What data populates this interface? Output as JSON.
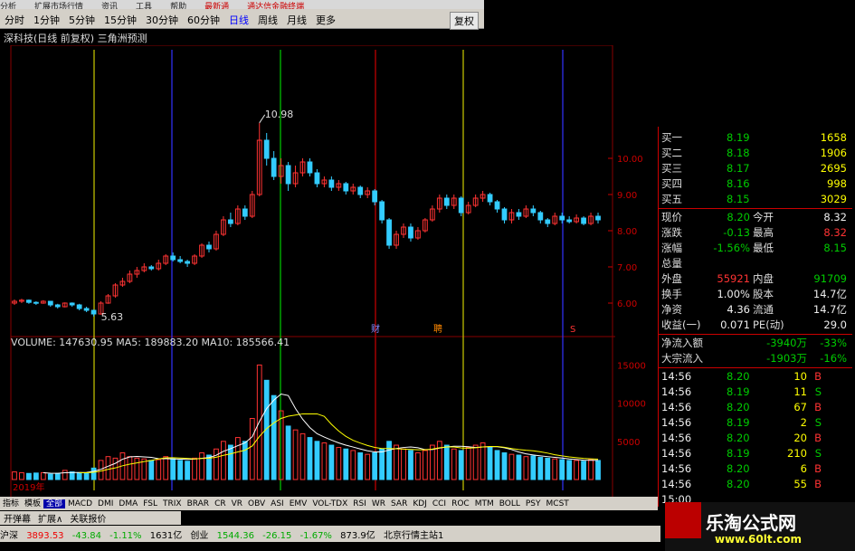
{
  "menubar": {
    "items": [
      "分析",
      "扩展市场行情",
      "资讯",
      "工具",
      "帮助"
    ],
    "red1": "最新通",
    "red2": "通达信金融终端"
  },
  "periods": [
    "分时",
    "1分钟",
    "5分钟",
    "15分钟",
    "30分钟",
    "60分钟",
    "日线",
    "周线",
    "月线",
    "更多"
  ],
  "active_period": "日线",
  "fuquan_btn": "复权",
  "chart_title": "深科技(日线 前复权) 三角洲预测",
  "price_high_label": "10.98",
  "price_low_label": "5.63",
  "year_label": "2019年",
  "event_labels": [
    "财",
    "聘",
    "S"
  ],
  "volume": {
    "label": "VOLUME: 147630.95",
    "ma5": "MA5: 189883.20",
    "ma10": "MA10: 185566.41"
  },
  "price_axis": [
    "10.00",
    "9.00",
    "8.00",
    "7.00",
    "6.00"
  ],
  "volume_axis": [
    "15000",
    "10000",
    "5000"
  ],
  "chart_data": {
    "type": "candlestick",
    "ylim": [
      5.5,
      11
    ],
    "volume_ylim": [
      0,
      16000
    ],
    "candles": [
      [
        6.0,
        6.05,
        6.1,
        5.95
      ],
      [
        6.05,
        6.08,
        6.12,
        6.0
      ],
      [
        6.08,
        6.02,
        6.1,
        5.98
      ],
      [
        6.02,
        6.0,
        6.05,
        5.95
      ],
      [
        6.0,
        6.05,
        6.08,
        5.98
      ],
      [
        6.05,
        5.95,
        6.06,
        5.9
      ],
      [
        5.95,
        5.9,
        5.98,
        5.85
      ],
      [
        5.9,
        6.0,
        6.02,
        5.88
      ],
      [
        6.0,
        5.95,
        6.02,
        5.9
      ],
      [
        5.95,
        5.85,
        5.98,
        5.8
      ],
      [
        5.85,
        5.8,
        5.9,
        5.75
      ],
      [
        5.8,
        5.7,
        5.82,
        5.63
      ],
      [
        5.7,
        6.0,
        6.05,
        5.68
      ],
      [
        6.0,
        6.2,
        6.25,
        5.98
      ],
      [
        6.2,
        6.5,
        6.55,
        6.15
      ],
      [
        6.5,
        6.6,
        6.7,
        6.45
      ],
      [
        6.6,
        6.8,
        6.9,
        6.55
      ],
      [
        6.8,
        6.9,
        7.0,
        6.7
      ],
      [
        6.9,
        7.0,
        7.1,
        6.85
      ],
      [
        7.0,
        6.95,
        7.05,
        6.9
      ],
      [
        6.95,
        7.1,
        7.2,
        6.9
      ],
      [
        7.1,
        7.3,
        7.35,
        7.05
      ],
      [
        7.3,
        7.2,
        7.4,
        7.15
      ],
      [
        7.2,
        7.15,
        7.3,
        7.1
      ],
      [
        7.15,
        7.1,
        7.2,
        7.0
      ],
      [
        7.1,
        7.3,
        7.35,
        7.05
      ],
      [
        7.3,
        7.6,
        7.65,
        7.25
      ],
      [
        7.6,
        7.5,
        7.7,
        7.4
      ],
      [
        7.5,
        7.9,
        8.0,
        7.45
      ],
      [
        7.9,
        8.3,
        8.4,
        7.85
      ],
      [
        8.3,
        8.2,
        8.5,
        8.1
      ],
      [
        8.2,
        8.6,
        8.7,
        8.15
      ],
      [
        8.6,
        8.4,
        8.7,
        8.3
      ],
      [
        8.4,
        9.0,
        9.1,
        8.35
      ],
      [
        9.0,
        10.5,
        10.98,
        8.95
      ],
      [
        10.5,
        10.0,
        10.7,
        9.8
      ],
      [
        10.0,
        9.5,
        10.2,
        9.4
      ],
      [
        9.5,
        9.8,
        10.0,
        9.3
      ],
      [
        9.8,
        9.3,
        9.9,
        9.1
      ],
      [
        9.3,
        9.6,
        9.8,
        9.2
      ],
      [
        9.6,
        9.9,
        10.0,
        9.5
      ],
      [
        9.9,
        9.6,
        10.0,
        9.5
      ],
      [
        9.6,
        9.3,
        9.7,
        9.2
      ],
      [
        9.3,
        9.4,
        9.5,
        9.2
      ],
      [
        9.4,
        9.2,
        9.5,
        9.1
      ],
      [
        9.2,
        9.3,
        9.4,
        9.1
      ],
      [
        9.3,
        9.1,
        9.35,
        9.0
      ],
      [
        9.1,
        9.2,
        9.3,
        9.0
      ],
      [
        9.2,
        9.0,
        9.25,
        8.9
      ],
      [
        9.0,
        9.1,
        9.2,
        8.9
      ],
      [
        9.1,
        8.8,
        9.15,
        8.7
      ],
      [
        8.8,
        8.3,
        8.85,
        8.2
      ],
      [
        8.3,
        7.6,
        8.35,
        7.5
      ],
      [
        7.6,
        7.9,
        8.0,
        7.5
      ],
      [
        7.9,
        8.1,
        8.2,
        7.8
      ],
      [
        8.1,
        7.8,
        8.2,
        7.7
      ],
      [
        7.8,
        8.0,
        8.1,
        7.75
      ],
      [
        8.0,
        8.3,
        8.35,
        7.95
      ],
      [
        8.3,
        8.6,
        8.7,
        8.25
      ],
      [
        8.6,
        8.9,
        9.0,
        8.5
      ],
      [
        8.9,
        8.7,
        9.0,
        8.6
      ],
      [
        8.7,
        8.9,
        9.0,
        8.6
      ],
      [
        8.9,
        8.5,
        8.95,
        8.4
      ],
      [
        8.5,
        8.7,
        8.8,
        8.45
      ],
      [
        8.7,
        8.9,
        9.0,
        8.65
      ],
      [
        8.9,
        9.0,
        9.1,
        8.8
      ],
      [
        9.0,
        8.8,
        9.05,
        8.7
      ],
      [
        8.8,
        8.6,
        8.85,
        8.5
      ],
      [
        8.6,
        8.3,
        8.65,
        8.2
      ],
      [
        8.3,
        8.5,
        8.6,
        8.2
      ],
      [
        8.5,
        8.4,
        8.6,
        8.3
      ],
      [
        8.4,
        8.6,
        8.7,
        8.35
      ],
      [
        8.6,
        8.5,
        8.7,
        8.4
      ],
      [
        8.5,
        8.3,
        8.55,
        8.2
      ],
      [
        8.3,
        8.2,
        8.35,
        8.1
      ],
      [
        8.2,
        8.4,
        8.5,
        8.15
      ],
      [
        8.4,
        8.3,
        8.5,
        8.2
      ],
      [
        8.3,
        8.25,
        8.4,
        8.2
      ],
      [
        8.25,
        8.35,
        8.45,
        8.2
      ],
      [
        8.35,
        8.2,
        8.4,
        8.15
      ],
      [
        8.2,
        8.4,
        8.5,
        8.15
      ],
      [
        8.4,
        8.3,
        8.5,
        8.2
      ]
    ],
    "volumes": [
      1000,
      900,
      800,
      850,
      900,
      700,
      800,
      1200,
      1000,
      900,
      800,
      1500,
      2500,
      3000,
      2800,
      3500,
      3000,
      2800,
      2700,
      2500,
      2600,
      3000,
      2700,
      2500,
      2400,
      2800,
      3500,
      3200,
      4000,
      5000,
      4500,
      5500,
      5000,
      8000,
      15000,
      13000,
      11000,
      9000,
      7000,
      6500,
      6000,
      5500,
      5000,
      4800,
      4500,
      4200,
      4000,
      3800,
      3500,
      3300,
      3500,
      4000,
      5000,
      4500,
      4000,
      3800,
      3500,
      3800,
      4500,
      5000,
      4500,
      4000,
      3800,
      4200,
      4500,
      4800,
      4200,
      3800,
      3500,
      3300,
      3200,
      3000,
      3100,
      2900,
      2800,
      2700,
      2600,
      2500,
      2500,
      2400,
      2600,
      2500
    ]
  },
  "quote": {
    "bids": [
      {
        "label": "买一",
        "price": "8.19",
        "vol": "1658"
      },
      {
        "label": "买二",
        "price": "8.18",
        "vol": "1906"
      },
      {
        "label": "买三",
        "price": "8.17",
        "vol": "2695"
      },
      {
        "label": "买四",
        "price": "8.16",
        "vol": "998"
      },
      {
        "label": "买五",
        "price": "8.15",
        "vol": "3029"
      }
    ],
    "stats": [
      {
        "l1": "现价",
        "v1": "8.20",
        "l2": "今开",
        "v2": "8.32"
      },
      {
        "l1": "涨跌",
        "v1": "-0.13",
        "l2": "最高",
        "v2": "8.32"
      },
      {
        "l1": "涨幅",
        "v1": "-1.56%",
        "l2": "最低",
        "v2": "8.15"
      },
      {
        "l1": "总量",
        "v1": "",
        "l2": "",
        "v2": ""
      },
      {
        "l1": "外盘",
        "v1": "55921",
        "l2": "内盘",
        "v2": "91709"
      },
      {
        "l1": "换手",
        "v1": "1.00%",
        "l2": "股本",
        "v2": "14.7亿"
      },
      {
        "l1": "净资",
        "v1": "4.36",
        "l2": "流通",
        "v2": "14.7亿"
      },
      {
        "l1": "收益(一)",
        "v1": "0.071",
        "l2": "PE(动)",
        "v2": "29.0"
      }
    ],
    "flows": [
      {
        "label": "净流入额",
        "v": "-3940万",
        "p": "-33%"
      },
      {
        "label": "大宗流入",
        "v": "-1903万",
        "p": "-16%"
      }
    ],
    "ticks": [
      {
        "t": "14:56",
        "p": "8.20",
        "v": "10",
        "s": "B"
      },
      {
        "t": "14:56",
        "p": "8.19",
        "v": "11",
        "s": "S"
      },
      {
        "t": "14:56",
        "p": "8.20",
        "v": "67",
        "s": "B"
      },
      {
        "t": "14:56",
        "p": "8.19",
        "v": "2",
        "s": "S"
      },
      {
        "t": "14:56",
        "p": "8.20",
        "v": "20",
        "s": "B"
      },
      {
        "t": "14:56",
        "p": "8.19",
        "v": "210",
        "s": "S"
      },
      {
        "t": "14:56",
        "p": "8.20",
        "v": "6",
        "s": "B"
      },
      {
        "t": "14:56",
        "p": "8.20",
        "v": "55",
        "s": "B"
      },
      {
        "t": "15:00",
        "p": "",
        "v": "",
        "s": ""
      }
    ]
  },
  "indicator_tabs": [
    "指标",
    "模板",
    "全部",
    "MACD",
    "DMI",
    "DMA",
    "FSL",
    "TRIX",
    "BRAR",
    "CR",
    "VR",
    "OBV",
    "ASI",
    "EMV",
    "VOL-TDX",
    "RSI",
    "WR",
    "SAR",
    "KDJ",
    "CCI",
    "ROC",
    "MTM",
    "BOLL",
    "PSY",
    "MCST"
  ],
  "bottom_tabs": [
    "开弹幕",
    "扩展∧",
    "关联报价"
  ],
  "status": {
    "sh_name": "沪深",
    "sh_val": "3893.53",
    "sh_chg": "-43.84",
    "sh_pct": "-1.11%",
    "sh_amt": "1631亿",
    "cy_name": "创业",
    "cy_val": "1544.36",
    "cy_chg": "-26.15",
    "cy_pct": "-1.67%",
    "cy_amt": "873.9亿",
    "server": "北京行情主站1"
  },
  "brand": {
    "name": "乐淘公式网",
    "url": "www.60lt.com"
  }
}
